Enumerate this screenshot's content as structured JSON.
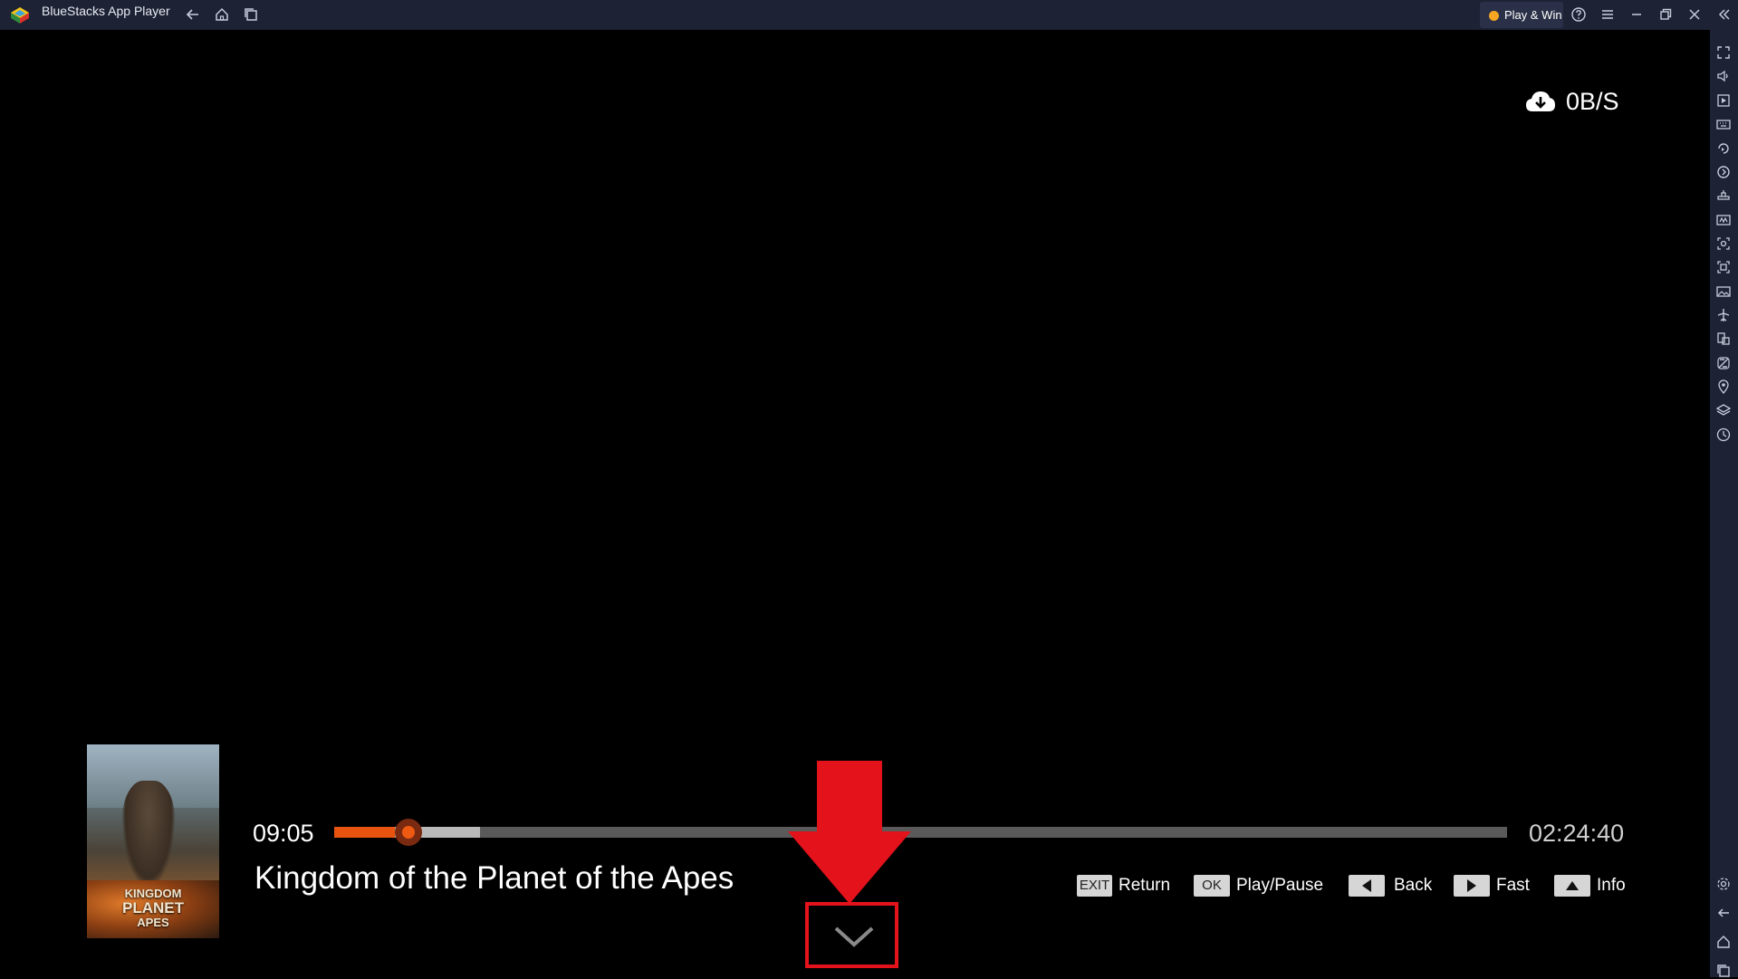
{
  "window": {
    "title": "BlueStacks App Player",
    "play_win_label": "Play & Win",
    "colors": {
      "titlebar": "#1d2235",
      "accent": "#f5a623"
    }
  },
  "titlebar_icons": [
    "back-icon",
    "home-icon",
    "recent-apps-icon",
    "help-icon",
    "menu-icon",
    "minimize-icon",
    "restore-icon",
    "close-icon",
    "collapse-sidebar-icon"
  ],
  "sidebar_icons": [
    "fullscreen-icon",
    "volume-icon",
    "media-icon",
    "keyboard-icon",
    "rotate-icon",
    "sync-icon",
    "game-controls-icon",
    "macro-icon",
    "screenshot-icon",
    "record-icon",
    "gallery-icon",
    "airplane-icon",
    "multi-instance-icon",
    "eco-mode-icon",
    "location-icon",
    "layers-icon",
    "clock-icon",
    "settings-icon",
    "android-back-icon",
    "android-home-icon",
    "android-recents-icon"
  ],
  "player": {
    "download_speed": "0B/S",
    "current_time": "09:05",
    "total_time": "02:24:40",
    "progress_fraction": 0.052,
    "buffer_fraction": 0.124,
    "title": "Kingdom of the Planet of the Apes",
    "poster_title_line1": "KINGDOM",
    "poster_title_line2": "PLANET",
    "poster_title_line3": "APES",
    "progress_color": "#e8540f"
  },
  "hints": [
    {
      "key": "EXIT",
      "label": "Return"
    },
    {
      "key": "OK",
      "label": "Play/Pause"
    },
    {
      "key": "",
      "key_icon": "left-triangle-icon",
      "label": "Back"
    },
    {
      "key": "",
      "key_icon": "right-triangle-icon",
      "label": "Fast"
    },
    {
      "key": "",
      "key_icon": "up-triangle-icon",
      "label": "Info"
    }
  ],
  "annotation": {
    "color": "#e3121b"
  }
}
